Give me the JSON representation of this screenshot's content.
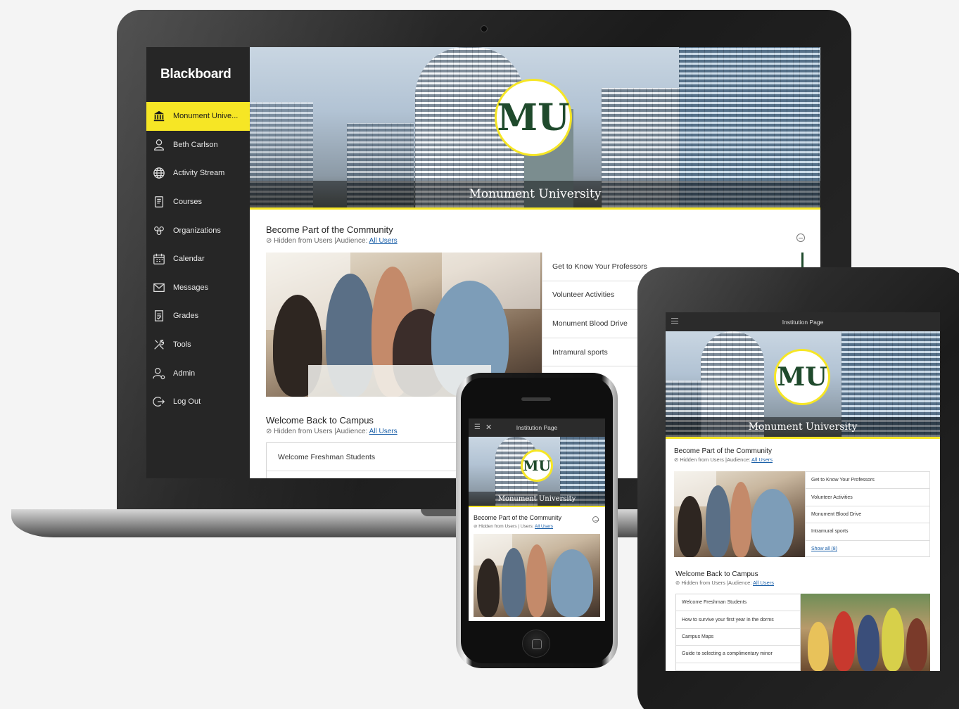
{
  "app": {
    "brand": "Blackboard"
  },
  "laptop": {
    "sidebar": {
      "items": [
        {
          "label": "Monument Unive...",
          "icon": "institution-icon",
          "active": true
        },
        {
          "label": "Beth Carlson",
          "icon": "user-icon"
        },
        {
          "label": "Activity Stream",
          "icon": "globe-icon"
        },
        {
          "label": "Courses",
          "icon": "courses-icon"
        },
        {
          "label": "Organizations",
          "icon": "organizations-icon"
        },
        {
          "label": "Calendar",
          "icon": "calendar-icon"
        },
        {
          "label": "Messages",
          "icon": "messages-icon"
        },
        {
          "label": "Grades",
          "icon": "grades-icon"
        },
        {
          "label": "Tools",
          "icon": "tools-icon"
        },
        {
          "label": "Admin",
          "icon": "admin-icon"
        },
        {
          "label": "Log Out",
          "icon": "logout-icon"
        }
      ]
    },
    "banner": {
      "title": "Monument University",
      "seal_text": "MU"
    },
    "community": {
      "title": "Become Part of the Community",
      "visibility": "Hidden from Users",
      "audience_label": "|Audience:",
      "audience_link": "All Users",
      "links": [
        "Get to Know Your Professors",
        "Volunteer Activities",
        "Monument Blood Drive",
        "Intramural sports"
      ]
    },
    "welcome": {
      "title": "Welcome Back to Campus",
      "visibility": "Hidden from Users",
      "audience_label": "|Audience:",
      "audience_link": "All Users",
      "links": [
        "Welcome Freshman Students"
      ]
    }
  },
  "tablet": {
    "topbar_title": "Institution Page",
    "banner": {
      "title": "Monument University",
      "seal_text": "MU"
    },
    "community": {
      "title": "Become Part of the Community",
      "visibility": "Hidden from Users",
      "audience_label": "|Audience:",
      "audience_link": "All Users",
      "links": [
        "Get to Know Your Professors",
        "Volunteer Activities",
        "Monument Blood Drive",
        "Intramural sports"
      ],
      "show_all": "Show all (8)"
    },
    "welcome": {
      "title": "Welcome Back to Campus",
      "visibility": "Hidden from Users",
      "audience_label": "|Audience:",
      "audience_link": "All Users",
      "links": [
        "Welcome Freshman Students",
        "How to survive your first year in the dorms",
        "Campus Maps",
        "Guide to selecting a complimentary minor"
      ]
    }
  },
  "phone": {
    "topbar_title": "Institution Page",
    "banner": {
      "title": "Monument University",
      "seal_text": "MU"
    },
    "community": {
      "title": "Become Part of the Community",
      "visibility": "Hidden from Users",
      "audience_label": "|",
      "audience_prefix": "Users:",
      "audience_link": "All Users"
    }
  },
  "colors": {
    "accent_yellow": "#f6e625",
    "sidebar_bg": "#262626",
    "seal_green": "#1f4a2c",
    "link_blue": "#1a5fa8"
  }
}
